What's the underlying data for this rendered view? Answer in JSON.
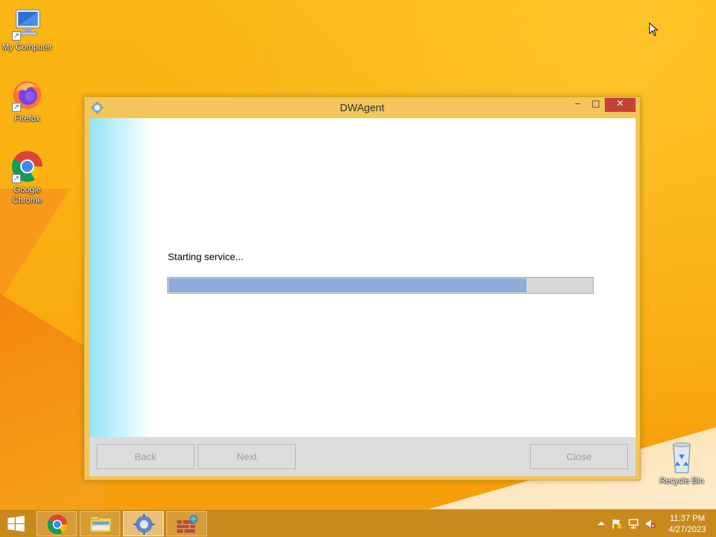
{
  "desktop": {
    "icons": [
      {
        "label": "My Computer",
        "icon": "computer-icon"
      },
      {
        "label": "Firefox",
        "icon": "firefox-icon"
      },
      {
        "label": "Google Chrome",
        "icon": "chrome-icon"
      },
      {
        "label": "Recycle Bin",
        "icon": "recycle-bin-icon"
      }
    ]
  },
  "window": {
    "title": "DWAgent",
    "controls": {
      "minimize": "‒",
      "maximize": "□",
      "close": "✕"
    },
    "status_text": "Starting service...",
    "progress_fraction": 0.845,
    "buttons": {
      "back": "Back",
      "next": "Next",
      "close": "Close"
    }
  },
  "taskbar": {
    "items": [
      "start-icon",
      "chrome-icon",
      "file-explorer-icon",
      "dwagent-icon",
      "firewall-icon"
    ],
    "tray": {
      "time": "11:37 PM",
      "date": "4/27/2023"
    }
  },
  "colors": {
    "accent": "#f9ac10",
    "close_button": "#c8403a",
    "progress_fill": "#8cacdc"
  }
}
